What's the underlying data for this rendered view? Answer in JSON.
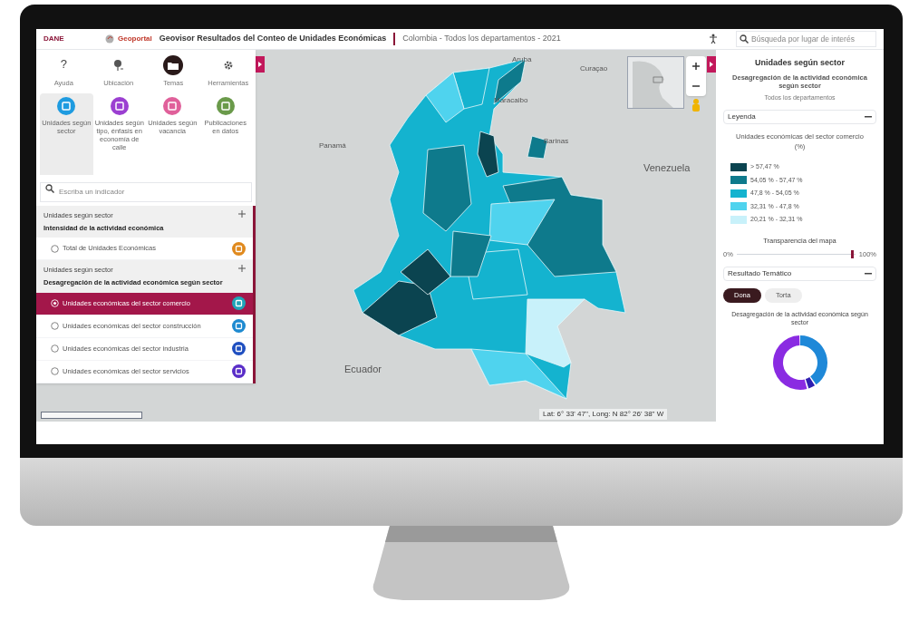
{
  "header": {
    "logo": "DANE",
    "portal_logo": "Geoportal",
    "title": "Geovisor Resultados del Conteo de Unidades Económicas",
    "subtitle": "Colombia - Todos los departamentos - 2021",
    "search": {
      "placeholder": "Búsqueda por lugar de interés"
    }
  },
  "toolbar": [
    {
      "kind": "help",
      "icon": "?",
      "label": "Ayuda",
      "selected": false
    },
    {
      "kind": "location",
      "label": "Ubicación",
      "selected": false
    },
    {
      "kind": "themes",
      "label": "Temas",
      "selected": true
    },
    {
      "kind": "tools",
      "label": "Herramientas",
      "selected": false
    }
  ],
  "themes": [
    {
      "label": "Unidades según sector",
      "color": "#1e9be0",
      "selected": true
    },
    {
      "label": "Unidades según tipo, énfasis en economía de calle",
      "color": "#9b3fd1",
      "selected": false
    },
    {
      "label": "Unidades según vacancia",
      "color": "#e0609a",
      "selected": false
    },
    {
      "label": "Publicaciones en datos",
      "color": "#6a9a4a",
      "selected": false
    }
  ],
  "indicator_search": {
    "placeholder": "Escriba un indicador"
  },
  "groups": [
    {
      "category": "Unidades según sector",
      "title": "Intensidad de la actividad económica",
      "items": [
        {
          "label": "Total de Unidades Económicas",
          "selected": false,
          "color": "#e08a1e"
        }
      ]
    },
    {
      "category": "Unidades según sector",
      "title": "Desagregación de la actividad económica según sector",
      "items": [
        {
          "label": "Unidades económicas del sector comercio",
          "selected": true,
          "color": "#1fa5b8"
        },
        {
          "label": "Unidades económicas del sector construcción",
          "selected": false,
          "color": "#1e8ad0"
        },
        {
          "label": "Unidades económicas del sector industria",
          "selected": false,
          "color": "#1f4fc0"
        },
        {
          "label": "Unidades económicas del sector servicios",
          "selected": false,
          "color": "#5a2ec8"
        }
      ]
    }
  ],
  "map": {
    "labels": [
      "Aruba",
      "Curaçao",
      "Maracaibo",
      "Barinas",
      "Panamá",
      "Venezuela",
      "Ecuador"
    ],
    "coordinates": "Lat: 6° 33' 47'', Long: N 82° 26' 38'' W"
  },
  "side_panel": {
    "title": "Unidades según sector",
    "subtitle": "Desagregación de la actividad económica según sector",
    "scope": "Todos los departamentos",
    "legend": {
      "header": "Leyenda",
      "title": "Unidades económicas del sector comercio (%)",
      "classes": [
        {
          "label": "> 57,47 %",
          "color": "#0b4450"
        },
        {
          "label": "54,05 % - 57,47 %",
          "color": "#0e7a8c"
        },
        {
          "label": "47,8 % - 54,05 %",
          "color": "#14b3cf"
        },
        {
          "label": "32,31 % - 47,8 %",
          "color": "#4fd3ee"
        },
        {
          "label": "20,21 % - 32,31 %",
          "color": "#c8f1fa"
        }
      ],
      "transparency": {
        "label": "Transparencia del mapa",
        "min": "0%",
        "max": "100%",
        "level": 0.96
      }
    },
    "result": {
      "header": "Resultado Temático",
      "tabs": [
        {
          "label": "Dona",
          "selected": true
        },
        {
          "label": "Torta",
          "selected": false
        }
      ],
      "chart_title": "Desagregación de la actividad económica según sector"
    }
  }
}
